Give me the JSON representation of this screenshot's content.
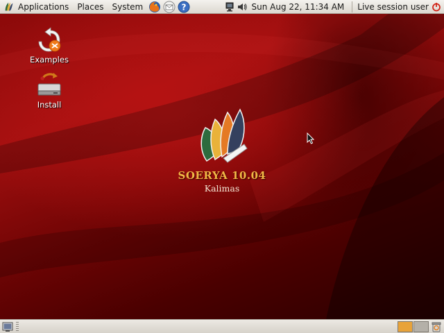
{
  "top_panel": {
    "menus": [
      {
        "label": "Applications"
      },
      {
        "label": "Places"
      },
      {
        "label": "System"
      }
    ],
    "launchers": [
      {
        "icon": "firefox-icon"
      },
      {
        "icon": "mail-icon"
      },
      {
        "icon": "help-icon"
      }
    ],
    "clock": "Sun Aug 22, 11:34 AM",
    "user": "Live session user",
    "tray_icons": [
      "network-icon",
      "volume-icon"
    ]
  },
  "desktop": {
    "icons": [
      {
        "label": "Examples",
        "icon": "examples-icon"
      },
      {
        "label": "Install",
        "icon": "install-icon"
      }
    ],
    "branding": {
      "name": "SOERYA 10.04",
      "codename": "Kalimas"
    }
  },
  "bottom_panel": {
    "workspaces": [
      "workspace-1",
      "workspace-2"
    ]
  },
  "colors": {
    "accent": "#f0b846",
    "background": "#8c0a0a",
    "panel": "#e6e3dd"
  }
}
